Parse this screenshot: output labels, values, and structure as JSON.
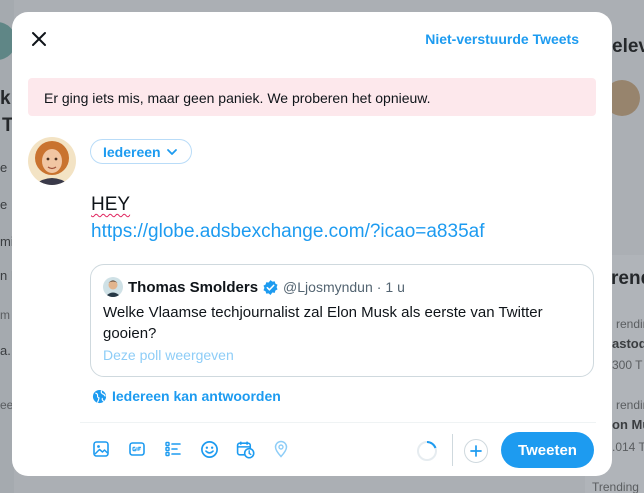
{
  "background": {
    "right_fragments": [
      "elev",
      "rending",
      "astod",
      "300 T",
      "rending",
      "on Mus",
      ".014 T",
      "Trending"
    ],
    "right_heading": "rend",
    "left_fragments": [
      "k",
      "T",
      "e",
      "e",
      "mi",
      "n F",
      "m",
      "a.",
      "ee"
    ]
  },
  "modal": {
    "unsent_link": "Niet-verstuurde Tweets",
    "error_message": "Er ging iets mis, maar geen paniek. We proberen het opnieuw.",
    "audience_label": "Iedereen",
    "tweet_text_line1": "HEY",
    "tweet_text_url": "https://globe.adsbexchange.com/?icao=a835af",
    "quote": {
      "name": "Thomas Smolders",
      "handle": "@Ljosmyndun",
      "separator": "·",
      "time": "1 u",
      "body": "Welke Vlaamse techjournalist zal Elon Musk als eerste van Twitter gooien?",
      "poll_link": "Deze poll weergeven"
    },
    "reply_setting": "Iedereen kan antwoorden",
    "tweet_button": "Tweeten"
  },
  "icons": [
    "close-icon",
    "chevron-down-icon",
    "verified-icon",
    "globe-icon",
    "image-icon",
    "gif-icon",
    "poll-icon",
    "emoji-icon",
    "schedule-icon",
    "location-icon",
    "character-counter-icon",
    "add-icon"
  ],
  "colors": {
    "accent": "#1d9bf0",
    "error_bg": "#fde8ec",
    "text": "#0f1419",
    "muted": "#536471"
  }
}
